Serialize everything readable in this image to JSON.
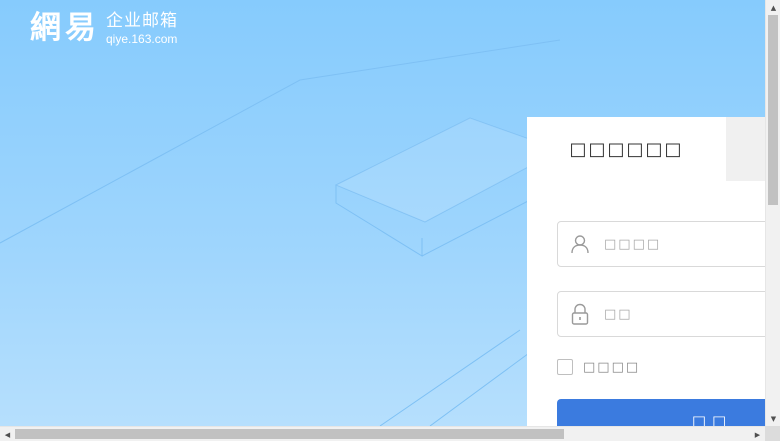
{
  "logo": {
    "mark": "網易",
    "name_cn": "企业邮箱",
    "domain": "qiye.163.com"
  },
  "login": {
    "active_tab_label": "□□□□□□",
    "username_placeholder": "□□□□",
    "password_placeholder": "□□",
    "remember_label": "□□□□",
    "submit_label": "□□"
  },
  "scrollbars": {
    "up_arrow": "▲",
    "down_arrow": "▼",
    "left_arrow": "◀",
    "right_arrow": "▶"
  },
  "colors": {
    "background_top": "#86cbfd",
    "background_bottom": "#b8e0fd",
    "button": "#3b7bdf",
    "inactive_tab": "#f0f0f0"
  }
}
